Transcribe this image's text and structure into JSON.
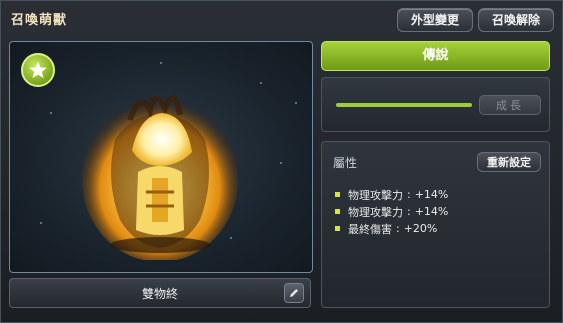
{
  "window": {
    "title": "召喚萌獸"
  },
  "header": {
    "appearance_label": "外型變更",
    "release_label": "召喚解除"
  },
  "pet": {
    "name": "雙物終",
    "rank_icon": "star-icon",
    "edit_icon": "pencil-icon"
  },
  "grade": {
    "label": "傳說",
    "color": "#8fbf24"
  },
  "growth": {
    "progress": 1.0,
    "button_label": "成長"
  },
  "attributes": {
    "title": "屬性",
    "reset_label": "重新設定",
    "items": [
      {
        "name": "物理攻擊力",
        "sep": ":",
        "value": "+14%"
      },
      {
        "name": "物理攻擊力",
        "sep": ":",
        "value": "+14%"
      },
      {
        "name": "最終傷害",
        "sep": ":",
        "value": "+20%"
      }
    ]
  }
}
